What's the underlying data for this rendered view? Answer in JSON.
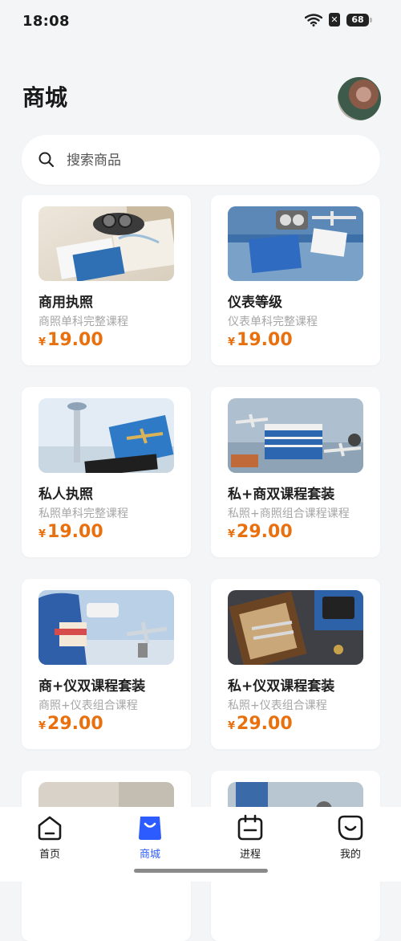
{
  "status": {
    "time": "18:08",
    "battery": "68"
  },
  "header": {
    "title": "商城"
  },
  "search": {
    "placeholder": "搜索商品"
  },
  "products": [
    {
      "title": "商用执照",
      "subtitle": "商照单科完整课程",
      "currency": "¥",
      "price": "19.00"
    },
    {
      "title": "仪表等级",
      "subtitle": "仪表单科完整课程",
      "currency": "¥",
      "price": "19.00"
    },
    {
      "title": "私人执照",
      "subtitle": "私照单科完整课程",
      "currency": "¥",
      "price": "19.00"
    },
    {
      "title": "私+商双课程套装",
      "subtitle": "私照+商照组合课程课程",
      "currency": "¥",
      "price": "29.00"
    },
    {
      "title": "商+仪双课程套装",
      "subtitle": "商照+仪表组合课程",
      "currency": "¥",
      "price": "29.00"
    },
    {
      "title": "私+仪双课程套装",
      "subtitle": "私照+仪表组合课程",
      "currency": "¥",
      "price": "29.00"
    }
  ],
  "tabs": [
    {
      "label": "首页",
      "icon": "home-icon"
    },
    {
      "label": "商城",
      "icon": "shop-bag-icon"
    },
    {
      "label": "进程",
      "icon": "calendar-icon"
    },
    {
      "label": "我的",
      "icon": "profile-face-icon"
    }
  ],
  "colors": {
    "accent": "#2c5cff",
    "price": "#e8700e",
    "background": "#f4f5f7"
  }
}
